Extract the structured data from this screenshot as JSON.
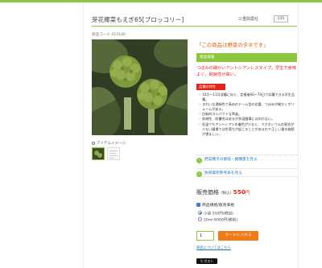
{
  "product": {
    "title": "芽花椰菜もえぎ65[ブロッコリー]",
    "maker": "三重興農社",
    "maker_badge": "235",
    "code": "商品コード 015180"
  },
  "images": {
    "label": "アイテムイメージ"
  },
  "description": {
    "catch": "「この商品は野菜のタネです」",
    "header": "商品情報",
    "lead": "つぼみの細かいアントシアンレスタイプ。早生で食味よく、耐病性が高い。",
    "features_header": "品種の特性",
    "features": [
      "10月〜11月収穫に向く、定植後60〜70日で収穫できる早生品種。",
      "きれいな濃緑色で高めのドーム型の花蕾、つぼみが細かくボリュームがある。",
      "比較的コンパクトな草姿。",
      "耐病性、耐暑性はあるが多湿圃場には向かない。",
      "低温でもアントシアンの着色が少なく、マグネシウムの割合が少ない圃場では色落ちが起こることがあるので正しい量の施肥が望ましい。"
    ]
  },
  "links": {
    "cultivation": "野菜種子の栽培・播種量を見る",
    "disease": "防除薬剤参考表を見る"
  },
  "purchase": {
    "price_label": "販売価格",
    "tax_label": "(税込)",
    "price": "550",
    "currency": "円",
    "spec_header": "商品規格/販売価格",
    "options": [
      {
        "label": "小袋 550円(税別)",
        "selected": true
      },
      {
        "label": "20ml 6000円(税別)",
        "selected": false
      }
    ],
    "quantity": "1",
    "cart_button": "カートに入れる",
    "inquiry_link": "商品についてはこちら"
  },
  "social": {
    "post_button": "ポスト"
  },
  "colors": {
    "accent_green": "#8cc63f",
    "price_red": "#e1251b",
    "catch_orange": "#e05a00",
    "cart_orange": "#f07a14"
  }
}
